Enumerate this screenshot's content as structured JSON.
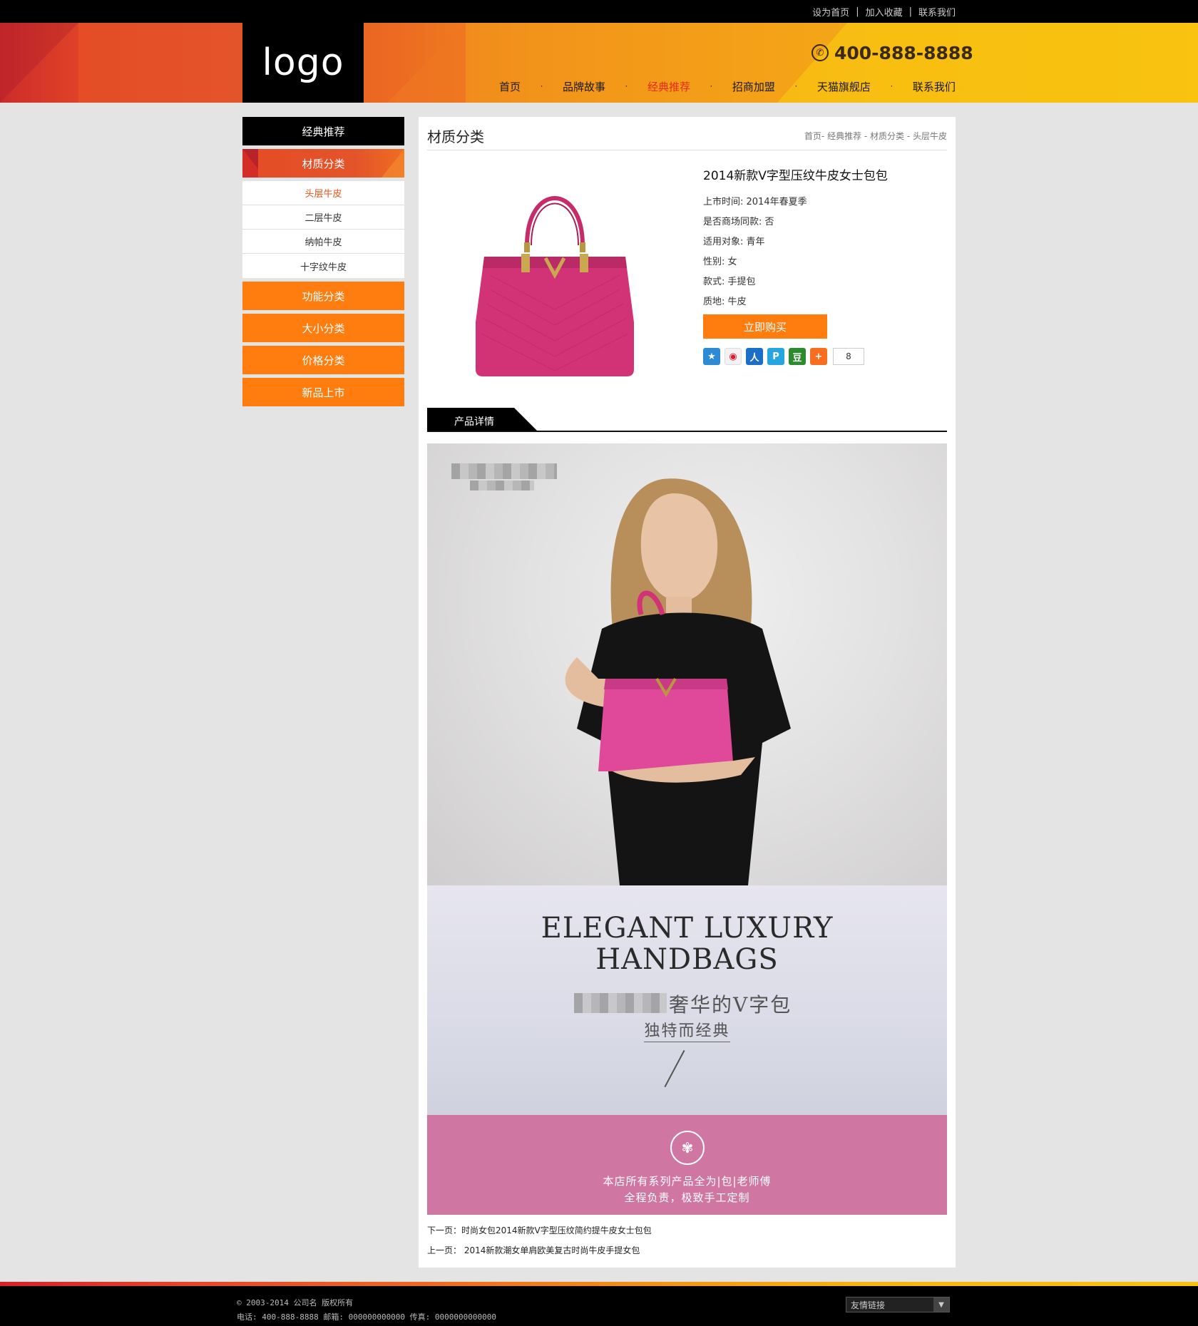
{
  "topbar": {
    "links": [
      "设为首页",
      "加入收藏",
      "联系我们"
    ],
    "separator": "|"
  },
  "header": {
    "logo": "logo",
    "phone": "400-888-8888",
    "phone_icon": "phone-icon",
    "nav": [
      "首页",
      "品牌故事",
      "经典推荐",
      "招商加盟",
      "天猫旗舰店",
      "联系我们"
    ],
    "nav_active": "经典推荐",
    "nav_separator": "·",
    "accent_color": "#e52a1c"
  },
  "sidebar": {
    "title": "经典推荐",
    "active_category": "材质分类",
    "subcategories": [
      "头层牛皮",
      "二层牛皮",
      "纳帕牛皮",
      "十字纹牛皮"
    ],
    "active_subcategory": "头层牛皮",
    "other_categories": [
      "功能分类",
      "大小分类",
      "价格分类",
      "新品上市"
    ],
    "orange_color": "#ff7d0f"
  },
  "main": {
    "title": "材质分类",
    "breadcrumb": "首页- 经典推荐 - 材质分类 - 头层牛皮",
    "product": {
      "title": "2014新款V字型压纹牛皮女士包包",
      "attributes": [
        "上市时间: 2014年春夏季",
        "是否商场同款: 否",
        "适用对象: 青年",
        "性别: 女",
        "款式: 手提包",
        "质地: 牛皮"
      ],
      "buy_label": "立即购买",
      "share_icons": [
        "qzone-icon",
        "weibo-icon",
        "renren-icon",
        "tencent-weibo-icon",
        "douban-icon",
        "more-share-icon"
      ],
      "share_count": "8",
      "bag_color": "#d23376"
    },
    "detail_tab": "产品详情",
    "banner": {
      "headline_line1": "ELEGANT LUXURY",
      "headline_line2": "HANDBAGS",
      "cn_line1": "奢华的V字包",
      "cn_line2": "独特而经典",
      "pink_line1": "本店所有系列产品全为|包|老师傅",
      "pink_line2": "全程负责，极致手工定制",
      "pink_color": "#d076a3"
    },
    "next_page": "下一页：时尚女包2014新款V字型压纹简约提牛皮女士包包",
    "prev_page": "上一页： 2014新款潮女单肩欧美复古时尚牛皮手提女包"
  },
  "footer": {
    "copyright": "© 2003-2014 公司名 版权所有",
    "contact": "电话: 400-888-8888 邮箱: 000000000000 传真: 0000000000000",
    "friend_links": "友情链接"
  }
}
